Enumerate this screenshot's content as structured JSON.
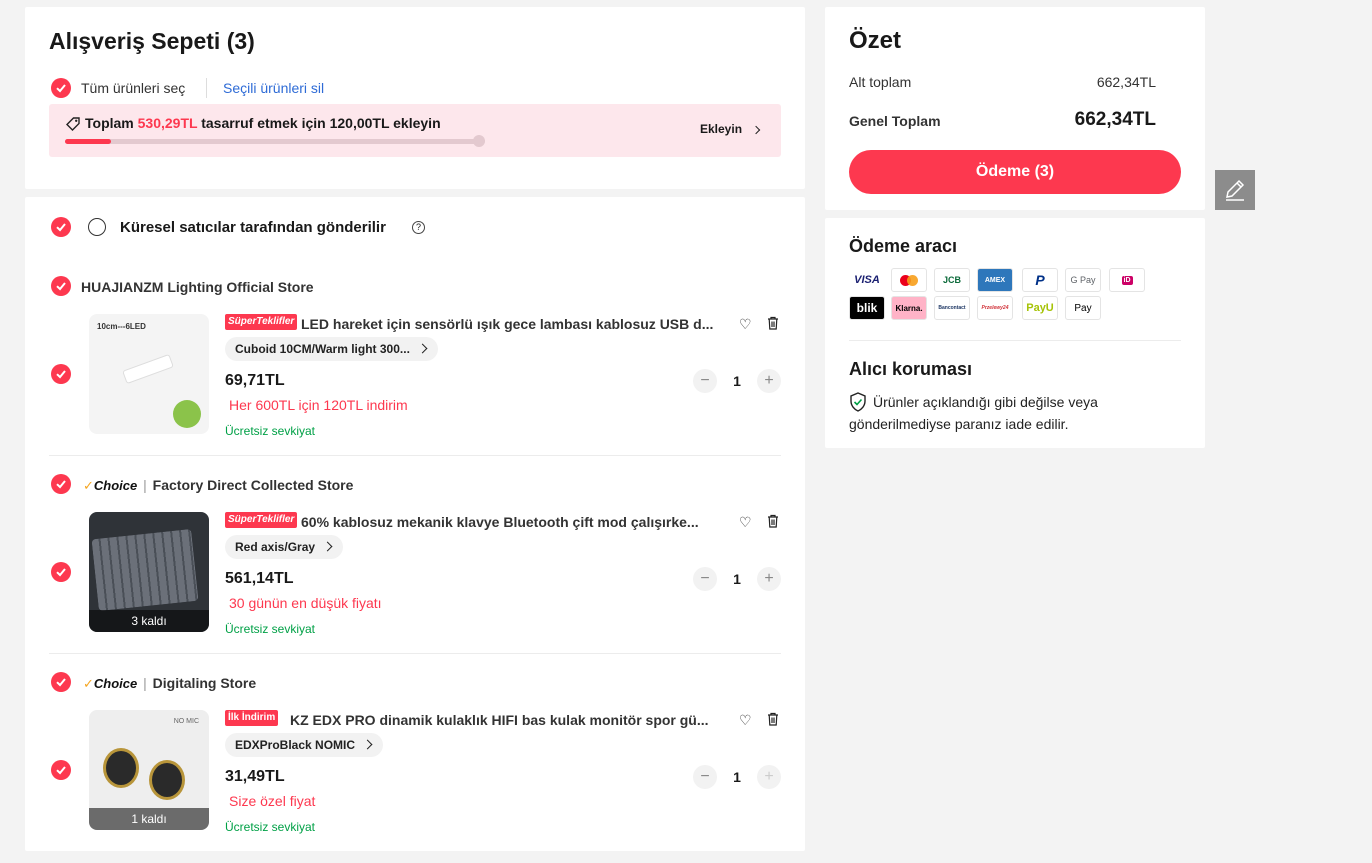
{
  "cart": {
    "title": "Alışveriş Sepeti (3)",
    "select_all": "Tüm ürünleri seç",
    "delete_selected": "Seçili ürünleri sil",
    "promo_prefix": "Toplam",
    "promo_amount": "530,29TL",
    "promo_suffix": "tasarruf etmek için 120,00TL ekleyin",
    "promo_action": "Ekleyin",
    "promo_progress": 0.11
  },
  "shipping_group": {
    "label": "Küresel satıcılar tarafından gönderilir"
  },
  "stores": [
    {
      "name": "HUAJIANZM Lighting Official Store",
      "choice": "",
      "item": {
        "badge": "SüperTeklifler",
        "title": "LED hareket için sensörlü ışık gece lambası kablosuz USB d...",
        "sku": "Cuboid 10CM/Warm light 300...",
        "price": "69,71TL",
        "promo": "Her 600TL için 120TL indirim",
        "shipping": "Ücretsiz sevkiyat",
        "qty": "1",
        "stock": "",
        "img_label": "10cm---6LED"
      }
    },
    {
      "name": "Factory Direct Collected Store",
      "choice": "Choice",
      "item": {
        "badge": "SüperTeklifler",
        "title": "60% kablosuz mekanik klavye Bluetooth çift mod çalışırke...",
        "sku": "Red axis/Gray",
        "price": "561,14TL",
        "promo": "30 günün en düşük fiyatı",
        "shipping": "Ücretsiz sevkiyat",
        "qty": "1",
        "stock": "3 kaldı"
      }
    },
    {
      "name": "Digitaling Store",
      "choice": "Choice",
      "item": {
        "badge": "İlk İndirim",
        "title": "KZ EDX PRO dinamik kulaklık HIFI bas kulak monitör spor gü...",
        "sku": "EDXProBlack NOMIC",
        "price": "31,49TL",
        "promo": "Size özel fiyat",
        "shipping": "Ücretsiz sevkiyat",
        "qty": "1",
        "stock": "1 kaldı",
        "img_label": "NO MIC"
      }
    }
  ],
  "summary": {
    "title": "Özet",
    "subtotal_label": "Alt toplam",
    "subtotal_value": "662,34TL",
    "total_label": "Genel Toplam",
    "total_value": "662,34TL",
    "checkout_label": "Ödeme (3)"
  },
  "payment": {
    "title": "Ödeme aracı",
    "methods": [
      "VISA",
      "Mastercard",
      "JCB",
      "AMEX",
      "PayPal",
      "G Pay",
      "iDEAL",
      "blik",
      "Klarna.",
      "Bancontact",
      "Przelewy24",
      "PayU",
      "Apple Pay"
    ]
  },
  "protection": {
    "title": "Alıcı koruması",
    "text": "Ürünler açıklandığı gibi değilse veya gönderilmediyse paranız iade edilir."
  },
  "colors": {
    "accent": "#fd384f",
    "promo_bg": "#fde7ec",
    "ship_green": "#00a046",
    "link_blue": "#2e6bd6"
  }
}
